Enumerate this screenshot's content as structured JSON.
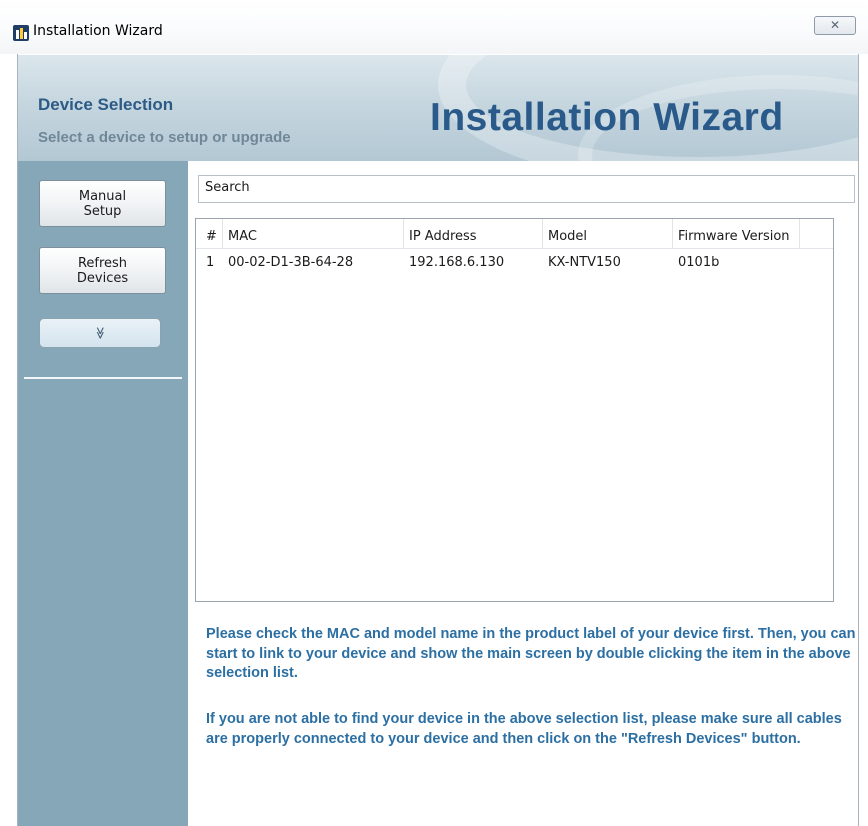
{
  "window": {
    "title": "Installation Wizard",
    "close_glyph": "✕"
  },
  "header": {
    "title": "Device Selection",
    "subtitle": "Select a device to setup or upgrade",
    "brand": "Installation Wizard"
  },
  "sidebar": {
    "manual_setup_label": "Manual\nSetup",
    "refresh_devices_label": "Refresh\nDevices",
    "expand_glyph": "≫"
  },
  "search": {
    "value": "Search"
  },
  "table": {
    "columns": [
      "#",
      "MAC",
      "IP Address",
      "Model",
      "Firmware Version"
    ],
    "rows": [
      [
        "1",
        "00-02-D1-3B-64-28",
        "192.168.6.130",
        "KX-NTV150",
        "0101b"
      ]
    ]
  },
  "info": {
    "paragraph1": "Please check the MAC and model name in the product label of your device first. Then, you can start to link to your device and show the main screen by double clicking the item in the above selection list.",
    "paragraph2": "If you are not able to find your device in the above selection list, please make sure all cables are properly connected to your device and then click on the \"Refresh Devices\" button."
  },
  "colors": {
    "sidebar": "#86a7b8",
    "accent_text": "#2c6fa3",
    "brand_text": "#295a8a"
  },
  "icons": {
    "app": "app-icon",
    "close": "close-icon",
    "expand": "chevron-down-icon"
  }
}
